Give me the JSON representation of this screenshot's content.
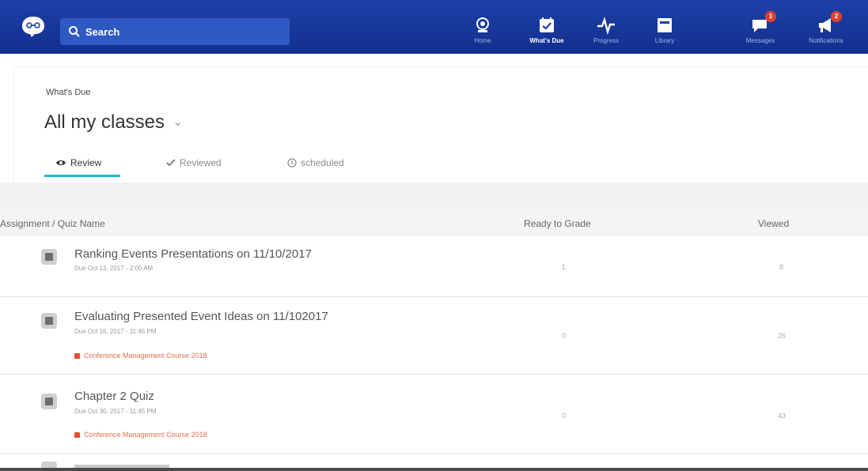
{
  "search": {
    "placeholder": "Search"
  },
  "nav": [
    {
      "label": "Home",
      "icon": "home-icon"
    },
    {
      "label": "What's Due",
      "icon": "calendar-check-icon",
      "active": true
    },
    {
      "label": "Progress",
      "icon": "pulse-icon"
    },
    {
      "label": "Library",
      "icon": "library-icon"
    },
    {
      "label": "Messages",
      "icon": "message-icon",
      "badge": "1"
    },
    {
      "label": "Notifications",
      "icon": "megaphone-icon",
      "badge": "2"
    }
  ],
  "header": {
    "breadcrumb": "What's Due",
    "title": "All my classes",
    "tabs": [
      {
        "label": "Review",
        "icon": "eye-icon",
        "active": true
      },
      {
        "label": "Reviewed",
        "icon": "checkmark-icon"
      },
      {
        "label": "scheduled",
        "icon": "clock-icon"
      }
    ]
  },
  "table": {
    "columns": [
      "Assignment / Quiz Name",
      "Ready to Grade",
      "Viewed"
    ],
    "rows": [
      {
        "title": "Ranking Events Presentations on 11/10/2017",
        "due": "Due Oct 13, 2017 - 2:00 AM",
        "course": "",
        "ready": "1",
        "viewed": "8"
      },
      {
        "title": "Evaluating Presented Event Ideas on 11/102017",
        "due": "Due Oct 16, 2017 - 11:45 PM",
        "course": "Conference Management Course 2018",
        "ready": "0",
        "viewed": "26"
      },
      {
        "title": "Chapter 2 Quiz",
        "due": "Due Oct 30, 2017 - 11:45 PM",
        "course": "Conference Management Course 2018",
        "ready": "0",
        "viewed": "43"
      }
    ]
  },
  "colors": {
    "topbar": "#1d3fa6",
    "accent": "#25b7c7",
    "course": "#e2502f",
    "badge": "#e0402f"
  }
}
